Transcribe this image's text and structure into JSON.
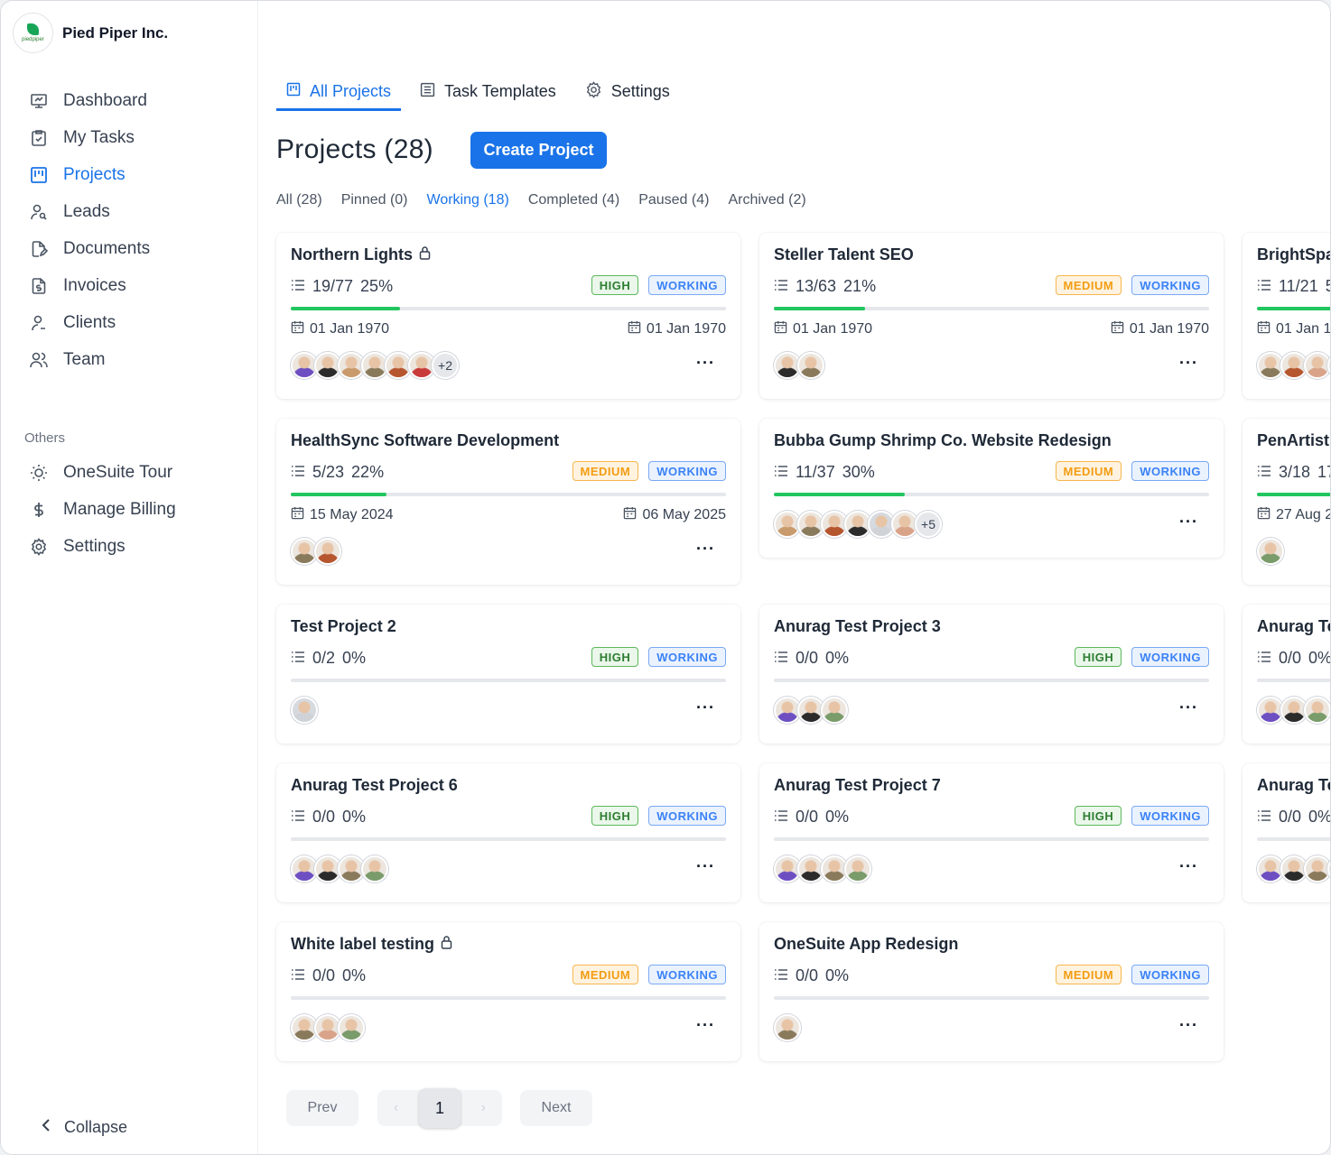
{
  "org": {
    "name": "Pied Piper Inc.",
    "logo_text": "piedpiper"
  },
  "sidebar": {
    "items": [
      {
        "label": "Dashboard",
        "icon": "presentation-icon"
      },
      {
        "label": "My Tasks",
        "icon": "clipboard-check-icon"
      },
      {
        "label": "Projects",
        "icon": "kanban-icon",
        "active": true
      },
      {
        "label": "Leads",
        "icon": "user-search-icon"
      },
      {
        "label": "Documents",
        "icon": "file-edit-icon"
      },
      {
        "label": "Invoices",
        "icon": "invoice-dollar-icon"
      },
      {
        "label": "Clients",
        "icon": "user-icon"
      },
      {
        "label": "Team",
        "icon": "users-icon"
      }
    ],
    "others_label": "Others",
    "others": [
      {
        "label": "OneSuite Tour",
        "icon": "sun-icon"
      },
      {
        "label": "Manage Billing",
        "icon": "dollar-icon"
      },
      {
        "label": "Settings",
        "icon": "gear-icon"
      }
    ],
    "collapse_label": "Collapse"
  },
  "tabs": [
    {
      "label": "All Projects",
      "icon": "kanban-icon",
      "active": true
    },
    {
      "label": "Task Templates",
      "icon": "list-doc-icon"
    },
    {
      "label": "Settings",
      "icon": "gear-icon"
    }
  ],
  "page": {
    "title": "Projects",
    "count": "(28)",
    "create_label": "Create Project"
  },
  "filters": [
    "All (28)",
    "Pinned (0)",
    "Working (18)",
    "Completed (4)",
    "Paused (4)",
    "Archived (2)"
  ],
  "active_filter": 2,
  "colors": {
    "accent": "#1a73e8",
    "progress": "#22c55e",
    "high": "#2e7d32",
    "medium": "#f39c12",
    "working": "#3b82f6"
  },
  "projects": [
    {
      "title": "Northern Lights",
      "locked": true,
      "tasks": "19/77",
      "percent": "25%",
      "progress": 0.25,
      "priority": "HIGH",
      "status": "WORKING",
      "start": "01 Jan 1970",
      "end": "01 Jan 1970",
      "extra": "+2"
    },
    {
      "title": "Steller Talent SEO",
      "locked": false,
      "tasks": "13/63",
      "percent": "21%",
      "progress": 0.21,
      "priority": "MEDIUM",
      "status": "WORKING",
      "start": "01 Jan 1970",
      "end": "01 Jan 1970",
      "extra": ""
    },
    {
      "title": "BrightSpa",
      "locked": false,
      "tasks": "11/21",
      "percent": "5",
      "progress": 0.5,
      "priority": "",
      "status": "",
      "start": "01 Jan 19",
      "end": "",
      "extra": ""
    },
    {
      "title": "HealthSync Software Development",
      "locked": false,
      "tasks": "5/23",
      "percent": "22%",
      "progress": 0.22,
      "priority": "MEDIUM",
      "status": "WORKING",
      "start": "15 May 2024",
      "end": "06 May 2025",
      "extra": ""
    },
    {
      "title": "Bubba Gump Shrimp Co. Website Redesign",
      "locked": false,
      "tasks": "11/37",
      "percent": "30%",
      "progress": 0.3,
      "priority": "MEDIUM",
      "status": "WORKING",
      "start": "",
      "end": "",
      "extra": "+5"
    },
    {
      "title": "PenArtist",
      "locked": false,
      "tasks": "3/18",
      "percent": "17",
      "progress": 0.17,
      "priority": "",
      "status": "",
      "start": "27 Aug 2",
      "end": "",
      "extra": ""
    },
    {
      "title": "Test Project 2",
      "locked": false,
      "tasks": "0/2",
      "percent": "0%",
      "progress": 0,
      "priority": "HIGH",
      "status": "WORKING",
      "start": "",
      "end": "",
      "extra": ""
    },
    {
      "title": "Anurag Test Project 3",
      "locked": false,
      "tasks": "0/0",
      "percent": "0%",
      "progress": 0,
      "priority": "HIGH",
      "status": "WORKING",
      "start": "",
      "end": "",
      "extra": ""
    },
    {
      "title": "Anurag Te",
      "locked": false,
      "tasks": "0/0",
      "percent": "0%",
      "progress": 0,
      "priority": "",
      "status": "",
      "start": "",
      "end": "",
      "extra": ""
    },
    {
      "title": "Anurag Test Project 6",
      "locked": false,
      "tasks": "0/0",
      "percent": "0%",
      "progress": 0,
      "priority": "HIGH",
      "status": "WORKING",
      "start": "",
      "end": "",
      "extra": ""
    },
    {
      "title": "Anurag Test Project 7",
      "locked": false,
      "tasks": "0/0",
      "percent": "0%",
      "progress": 0,
      "priority": "HIGH",
      "status": "WORKING",
      "start": "",
      "end": "",
      "extra": ""
    },
    {
      "title": "Anurag Te",
      "locked": false,
      "tasks": "0/0",
      "percent": "0%",
      "progress": 0,
      "priority": "",
      "status": "",
      "start": "",
      "end": "",
      "extra": ""
    },
    {
      "title": "White label testing",
      "locked": true,
      "tasks": "0/0",
      "percent": "0%",
      "progress": 0,
      "priority": "MEDIUM",
      "status": "WORKING",
      "start": "",
      "end": "",
      "extra": ""
    },
    {
      "title": "OneSuite App Redesign",
      "locked": false,
      "tasks": "0/0",
      "percent": "0%",
      "progress": 0,
      "priority": "MEDIUM",
      "status": "WORKING",
      "start": "",
      "end": "",
      "extra": ""
    }
  ],
  "card_menu": "···",
  "pagination": {
    "prev": "Prev",
    "next": "Next",
    "page": "1"
  }
}
